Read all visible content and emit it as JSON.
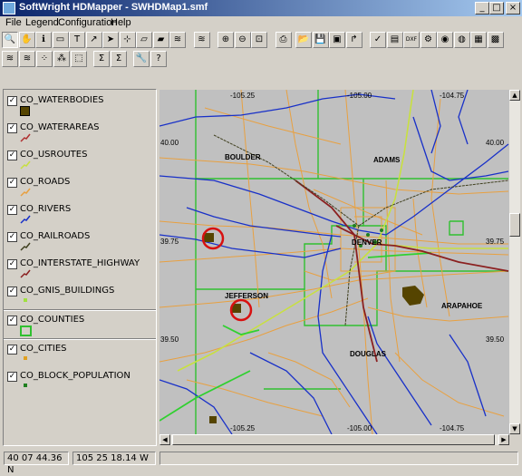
{
  "window": {
    "title": "SoftWright HDMapper - SWHDMap1.smf",
    "buttons": {
      "minimize": "_",
      "maximize": "□",
      "close": "×"
    }
  },
  "menu": [
    "File",
    "Legend",
    "Configuration",
    "Help"
  ],
  "toolbar1": [
    {
      "name": "zoom-tool",
      "glyph": "🔍"
    },
    {
      "name": "pan-tool",
      "glyph": "✋"
    },
    {
      "name": "info-tool",
      "glyph": "ℹ"
    },
    {
      "name": "label-tool",
      "glyph": "▭"
    },
    {
      "name": "text-tool",
      "glyph": "T"
    },
    {
      "name": "line-tool",
      "glyph": "↗"
    },
    {
      "name": "select-tool",
      "glyph": "➤"
    },
    {
      "name": "node-tool",
      "glyph": "⊹"
    },
    {
      "name": "area-tool",
      "glyph": "▱"
    },
    {
      "name": "edit-area-tool",
      "glyph": "▰"
    },
    {
      "name": "layers-tool",
      "glyph": "≋"
    },
    {
      "name": "layers2-tool",
      "glyph": "≋"
    },
    {
      "name": "zoom-in",
      "glyph": "⊕"
    },
    {
      "name": "zoom-out",
      "glyph": "⊖"
    },
    {
      "name": "zoom-full",
      "glyph": "⊡"
    },
    {
      "name": "print",
      "glyph": "⎙"
    },
    {
      "name": "open",
      "glyph": "📂"
    },
    {
      "name": "save",
      "glyph": "💾"
    },
    {
      "name": "save-as",
      "glyph": "▣"
    },
    {
      "name": "export",
      "glyph": "↱"
    },
    {
      "name": "check",
      "glyph": "✓"
    },
    {
      "name": "import",
      "glyph": "▤"
    },
    {
      "name": "dxf",
      "glyph": "DXF"
    },
    {
      "name": "settings",
      "glyph": "⚙"
    },
    {
      "name": "globe",
      "glyph": "◉"
    },
    {
      "name": "palette",
      "glyph": "◍"
    },
    {
      "name": "grid",
      "glyph": "▦"
    },
    {
      "name": "monitor",
      "glyph": "▩"
    }
  ],
  "toolbar2": [
    {
      "name": "layer-add",
      "glyph": "≋"
    },
    {
      "name": "layer-style",
      "glyph": "≋"
    },
    {
      "name": "points",
      "glyph": "⁘"
    },
    {
      "name": "point-edit",
      "glyph": "⁂"
    },
    {
      "name": "move",
      "glyph": "⬚"
    },
    {
      "name": "sum",
      "glyph": "Σ"
    },
    {
      "name": "sum-alt",
      "glyph": "Σ"
    },
    {
      "name": "wrench",
      "glyph": "🔧"
    },
    {
      "name": "help",
      "glyph": "?"
    }
  ],
  "layers": [
    {
      "label": "CO_WATERBODIES",
      "checked": "✓",
      "symbol": "fill",
      "color": "#554400"
    },
    {
      "label": "CO_WATERAREAS",
      "checked": "✓",
      "symbol": "line",
      "color": "#b03030"
    },
    {
      "label": "CO_USROUTES",
      "checked": "✓",
      "symbol": "line",
      "color": "#c8e040"
    },
    {
      "label": "CO_ROADS",
      "checked": "✓",
      "symbol": "line",
      "color": "#e8a040"
    },
    {
      "label": "CO_RIVERS",
      "checked": "✓",
      "symbol": "line",
      "color": "#1830c8"
    },
    {
      "label": "CO_RAILROADS",
      "checked": "✓",
      "symbol": "line",
      "color": "#404020"
    },
    {
      "label": "CO_INTERSTATE_HIGHWAY",
      "checked": "✓",
      "symbol": "line",
      "color": "#8b2020"
    },
    {
      "label": "CO_GNIS_BUILDINGS",
      "checked": "✓",
      "symbol": "dot",
      "color": "#a0e040"
    },
    {
      "label": "CO_COUNTIES",
      "checked": "✓",
      "symbol": "box",
      "color": "#30c030"
    },
    {
      "label": "CO_CITIES",
      "checked": "✓",
      "symbol": "dot",
      "color": "#e0a020"
    },
    {
      "label": "CO_BLOCK_POPULATION",
      "checked": "✓",
      "symbol": "dot",
      "color": "#208020"
    }
  ],
  "map": {
    "top_coords": [
      "-105.25",
      "-105.00",
      "-104.75"
    ],
    "bottom_coords": [
      "-105.25",
      "-105.00",
      "-104.75"
    ],
    "left_coords": [
      "40.00",
      "39.75",
      "39.50"
    ],
    "right_coords": [
      "40.00",
      "39.75",
      "39.50"
    ],
    "places": [
      "BOULDER",
      "ADAMS",
      "DENVER",
      "JEFFERSON",
      "ARAPAHOE",
      "DOUGLAS"
    ]
  },
  "status": {
    "lat": "40 07 44.36 N",
    "lon": "105 25 18.14 W"
  }
}
